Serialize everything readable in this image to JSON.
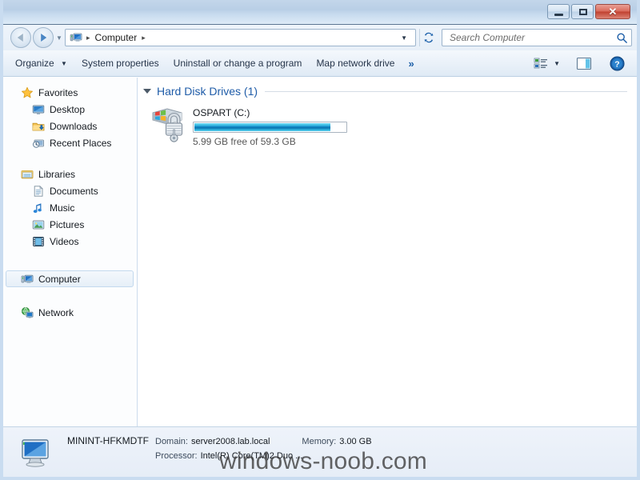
{
  "window": {
    "controls": {
      "minimize": "–",
      "maximize": "□",
      "close": "✕"
    }
  },
  "address_bar": {
    "back_icon": "back-arrow",
    "forward_icon": "forward-arrow",
    "recent_icon": "chevron-down",
    "location_icon": "computer-icon",
    "crumbs": [
      {
        "label": "Computer",
        "sep": "▸"
      }
    ],
    "leading_sep": "▸",
    "dropdown_icon": "▼",
    "refresh_icon": "refresh-icon"
  },
  "search": {
    "placeholder": "Search Computer",
    "value": "",
    "icon": "search-icon"
  },
  "toolbar": {
    "items": [
      {
        "label": "Organize",
        "has_caret": true
      },
      {
        "label": "System properties",
        "has_caret": false
      },
      {
        "label": "Uninstall or change a program",
        "has_caret": false
      },
      {
        "label": "Map network drive",
        "has_caret": false
      }
    ],
    "caret": "▼",
    "overflow": "»",
    "views_icon": "views-icon",
    "views_caret": "▼",
    "preview_icon": "preview-pane-icon",
    "help_icon": "help-icon"
  },
  "sidebar": {
    "groups": [
      {
        "header": {
          "label": "Favorites",
          "icon": "star-icon"
        },
        "items": [
          {
            "label": "Desktop",
            "icon": "desktop-icon"
          },
          {
            "label": "Downloads",
            "icon": "downloads-folder-icon"
          },
          {
            "label": "Recent Places",
            "icon": "recent-places-icon"
          }
        ]
      },
      {
        "header": {
          "label": "Libraries",
          "icon": "libraries-icon"
        },
        "items": [
          {
            "label": "Documents",
            "icon": "document-icon"
          },
          {
            "label": "Music",
            "icon": "music-note-icon"
          },
          {
            "label": "Pictures",
            "icon": "picture-icon"
          },
          {
            "label": "Videos",
            "icon": "video-film-icon"
          }
        ]
      },
      {
        "header": {
          "label": "Computer",
          "icon": "computer-icon",
          "selected": true
        },
        "items": []
      },
      {
        "header": {
          "label": "Network",
          "icon": "network-icon"
        },
        "items": []
      }
    ]
  },
  "content": {
    "group": {
      "title": "Hard Disk Drives (1)",
      "collapse_icon": "collapse-triangle"
    },
    "drive": {
      "name": "OSPART (C:)",
      "icon": "bitlocker-drive-icon",
      "free_text": "5.99 GB free of 59.3 GB",
      "free_gb": 5.99,
      "total_gb": 59.3,
      "used_percent": 90,
      "bar_fill_color": "#0f86c4"
    }
  },
  "status_bar": {
    "icon": "computer-icon",
    "machine_name": "MININT-HFKMDTF",
    "domain_label": "Domain:",
    "domain_value": "server2008.lab.local",
    "memory_label": "Memory:",
    "memory_value": "3.00 GB",
    "processor_label": "Processor:",
    "processor_value": "Intel(R) Core(TM)2 Duo ..."
  },
  "watermark": {
    "text": "windows-noob.com"
  }
}
